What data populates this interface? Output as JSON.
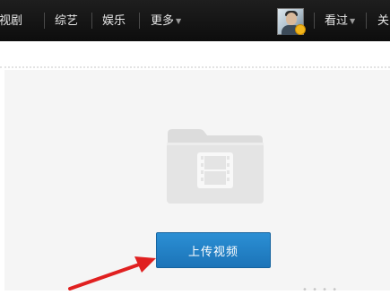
{
  "nav": {
    "items": [
      {
        "label": "视剧"
      },
      {
        "label": "综艺"
      },
      {
        "label": "娱乐"
      },
      {
        "label": "更多"
      }
    ],
    "history_label": "看过",
    "more_right_label": "关"
  },
  "upload": {
    "button_label": "上传视频"
  },
  "colors": {
    "nav_bg": "#141414",
    "button_bg": "#1f7fc6",
    "arrow": "#e02020"
  }
}
